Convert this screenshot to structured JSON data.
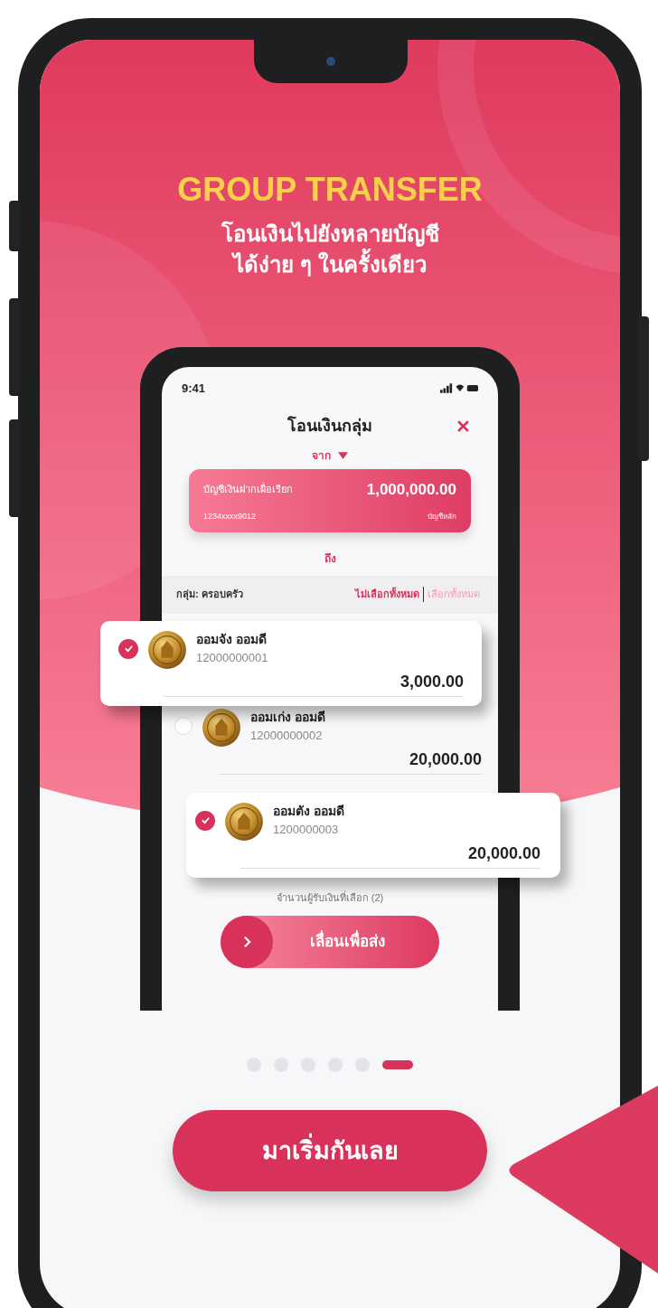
{
  "promo": {
    "title": "GROUP TRANSFER",
    "subtitle_lines": [
      "โอนเงินไปยังหลายบัญชี",
      "ได้ง่าย ๆ ในครั้งเดียว"
    ]
  },
  "app_screen": {
    "status_time": "9:41",
    "title": "โอนเงินกลุ่ม",
    "from_label": "จาก",
    "account": {
      "name": "บัญชีเงินฝากเผื่อเรียก",
      "balance": "1,000,000.00",
      "number": "1234xxxx9012",
      "tag": "บัญชีหลัก"
    },
    "to_label": "ถึง",
    "group_label": "กลุ่ม: ครอบครัว",
    "group_actions": [
      {
        "label": "ไม่เลือกทั้งหมด",
        "disabled": false
      },
      {
        "label": "เลือกทั้งหมด",
        "disabled": true
      }
    ],
    "recipients": [
      {
        "kind": "raised",
        "name": "ออมจัง ออมดี",
        "account": "12000000001",
        "amount": "3,000.00",
        "checked": true
      },
      {
        "kind": "inline",
        "name": "ออมเก่ง ออมดี",
        "account": "12000000002",
        "amount": "20,000.00",
        "checked": false
      },
      {
        "kind": "raised",
        "name": "ออมตัง ออมดี",
        "account": "1200000003",
        "amount": "20,000.00",
        "checked": true
      }
    ],
    "selected_count": "จำนวนผู้รับเงินที่เลือก (2)",
    "slide_button": "เลื่อนเพื่อส่ง"
  },
  "pager": [
    {
      "selected": false
    },
    {
      "selected": false
    },
    {
      "selected": false
    },
    {
      "selected": false
    },
    {
      "selected": false
    },
    {
      "selected": true
    }
  ],
  "start_button": "มาเริ่มกันเลย"
}
